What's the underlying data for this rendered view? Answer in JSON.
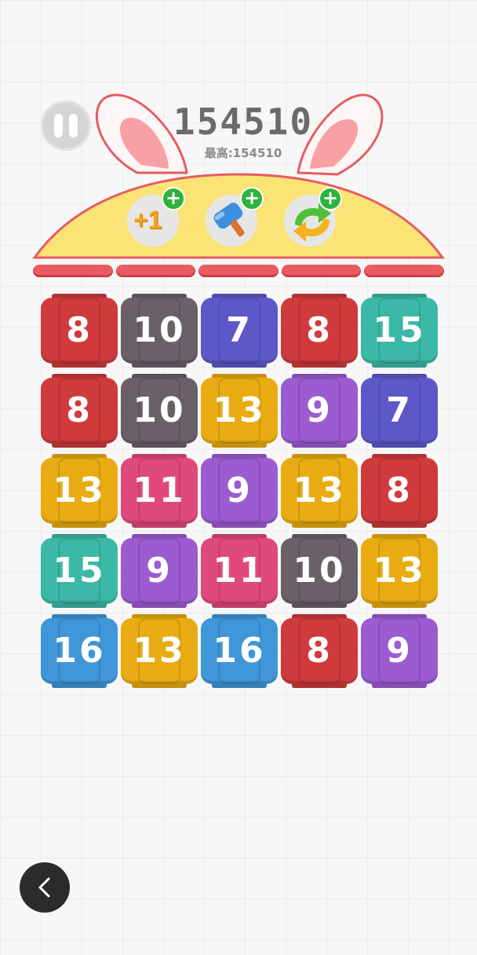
{
  "status": {
    "left": "",
    "right": ""
  },
  "score": "154510",
  "best": "最高:154510",
  "powerups": [
    {
      "id": "plus-one",
      "label": "+1",
      "icon": "plus-one-icon",
      "badge": "+"
    },
    {
      "id": "hammer",
      "label": "",
      "icon": "hammer-icon",
      "badge": "+"
    },
    {
      "id": "shuffle",
      "label": "",
      "icon": "shuffle-arrows-icon",
      "badge": "+"
    }
  ],
  "progress_segments": 5,
  "colors": {
    "7": "#5c58c8",
    "8": "#cf3a3c",
    "9": "#9b5bd1",
    "10": "#6a6068",
    "11": "#e0497c",
    "13": "#e8ab12",
    "15": "#3bb8a6",
    "16": "#3f97d9"
  },
  "board": [
    [
      "8",
      "10",
      "7",
      "8",
      "15"
    ],
    [
      "8",
      "10",
      "13",
      "9",
      "7"
    ],
    [
      "13",
      "11",
      "9",
      "13",
      "8"
    ],
    [
      "15",
      "9",
      "11",
      "10",
      "13"
    ],
    [
      "16",
      "13",
      "16",
      "8",
      "9"
    ]
  ]
}
